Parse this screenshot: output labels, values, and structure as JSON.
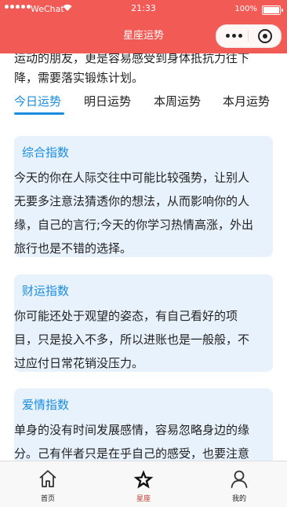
{
  "status_bar": {
    "carrier": "WeChat",
    "time": "21:33",
    "battery": "100%"
  },
  "nav": {
    "title": "星座运势"
  },
  "intro_lines": [
    "运动的朋友，更是容易感受到身体抵抗力往下",
    "降，需要落实锻炼计划。"
  ],
  "tabs": [
    {
      "label": "今日运势",
      "active": true
    },
    {
      "label": "明日运势",
      "active": false
    },
    {
      "label": "本周运势",
      "active": false
    },
    {
      "label": "本月运势",
      "active": false
    }
  ],
  "cards": [
    {
      "title": "综合指数",
      "lines": [
        "今天的你在人际交往中可能比较强势，让别人",
        "无要多注意法猜透你的想法，从而影响你的人",
        "缘，自己的言行;今天的你学习热情高涨，外出",
        "旅行也是不错的选择。"
      ]
    },
    {
      "title": "财运指数",
      "lines": [
        "你可能还处于观望的姿态，有自己看好的项",
        "目，只是投入不多，所以进账也是一般般，不",
        "过应付日常花销没压力。"
      ]
    },
    {
      "title": "爱情指数",
      "lines": [
        "单身的没有时间发展感情，容易忽略身边的缘",
        "分。己有伴者只是在乎自己的感受，也要注意"
      ]
    }
  ],
  "tabbar": [
    {
      "label": "首页",
      "icon": "home-icon",
      "active": false
    },
    {
      "label": "星座",
      "icon": "star-icon",
      "active": true
    },
    {
      "label": "我的",
      "icon": "user-icon",
      "active": false
    }
  ],
  "colors": {
    "header": "#f25a55",
    "accent": "#1a8de0",
    "card_bg": "#e8f2fd",
    "tab_active": "#c0392b"
  }
}
